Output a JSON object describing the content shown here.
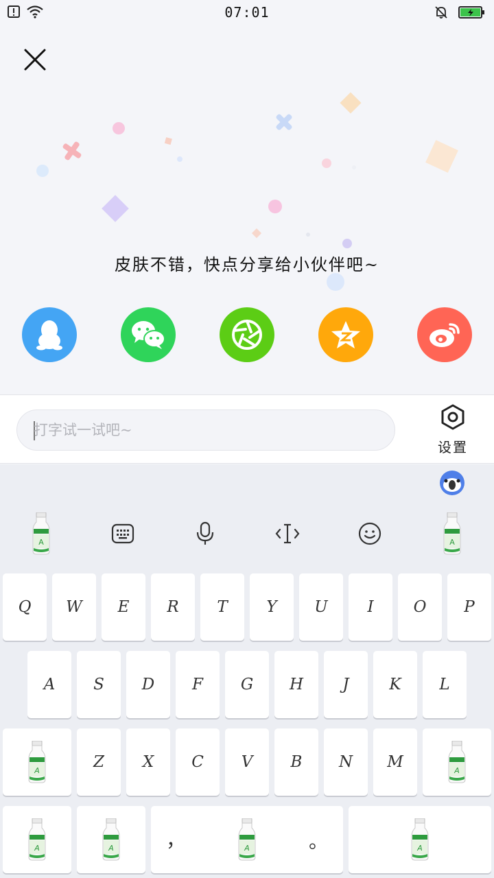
{
  "status_bar": {
    "time": "07:01",
    "icons": [
      "sim-alert-icon",
      "wifi-icon",
      "mute-bell-icon",
      "battery-charging-icon"
    ]
  },
  "header": {
    "close_icon": "close-icon"
  },
  "share": {
    "prompt": "皮肤不错，快点分享给小伙伴吧~",
    "targets": [
      {
        "name": "qq",
        "icon": "qq-penguin-icon",
        "color": "#44a5f4"
      },
      {
        "name": "wechat",
        "icon": "wechat-icon",
        "color": "#2fd45a"
      },
      {
        "name": "moments",
        "icon": "moments-aperture-icon",
        "color": "#5ccd15"
      },
      {
        "name": "qzone",
        "icon": "qzone-star-icon",
        "color": "#ffa80b"
      },
      {
        "name": "weibo",
        "icon": "weibo-icon",
        "color": "#ff6555"
      }
    ]
  },
  "input": {
    "placeholder": "打字试一试吧~",
    "value": ""
  },
  "settings": {
    "label": "设置",
    "icon": "hexagon-gear-icon"
  },
  "keyboard": {
    "toolbar": [
      "bottle-icon",
      "keyboard-icon",
      "microphone-icon",
      "text-cursor-icon",
      "smiley-icon",
      "bottle-icon"
    ],
    "row1": [
      "Q",
      "W",
      "E",
      "R",
      "T",
      "Y",
      "U",
      "I",
      "O",
      "P"
    ],
    "row2": [
      "A",
      "S",
      "D",
      "F",
      "G",
      "H",
      "J",
      "K",
      "L"
    ],
    "row3": [
      "Z",
      "X",
      "C",
      "V",
      "B",
      "N",
      "M"
    ],
    "comma": "，",
    "period": "。"
  }
}
